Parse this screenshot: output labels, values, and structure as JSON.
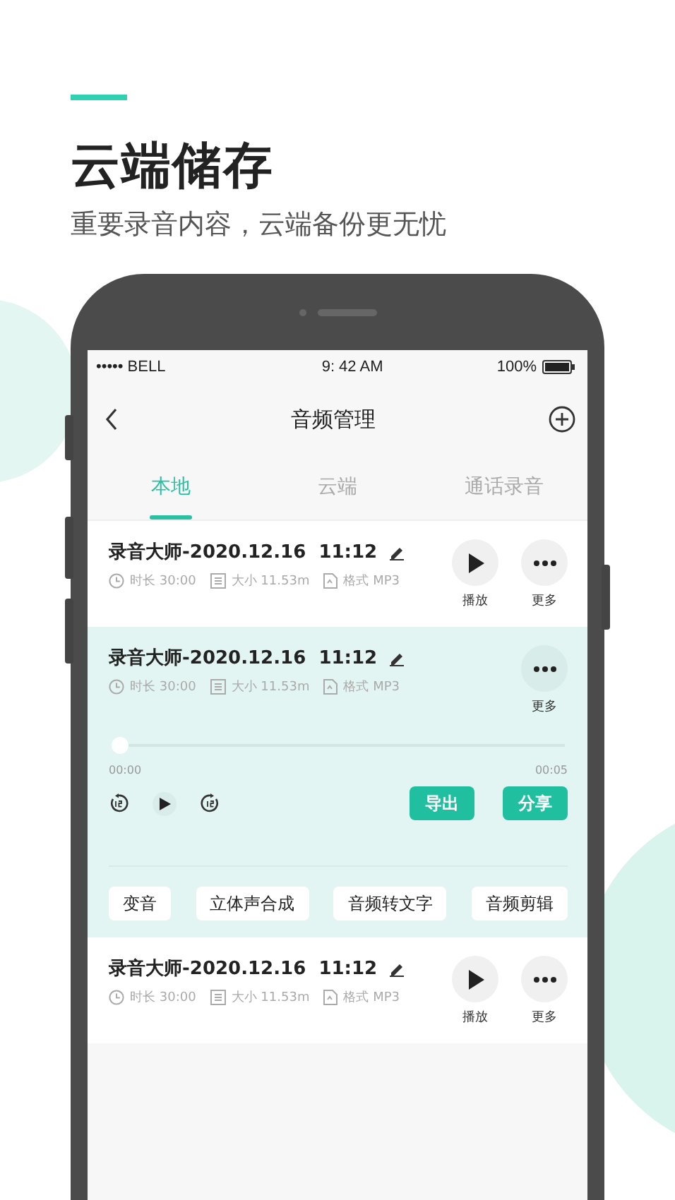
{
  "header": {
    "title": "云端储存",
    "subtitle": "重要录音内容，云端备份更无忧"
  },
  "status_bar": {
    "carrier": "••••• BELL",
    "time": "9: 42 AM",
    "battery": "100%"
  },
  "nav": {
    "title": "音频管理"
  },
  "tabs": [
    {
      "label": "本地",
      "selected": true
    },
    {
      "label": "云端",
      "selected": false
    },
    {
      "label": "通话录音",
      "selected": false
    }
  ],
  "recordings": [
    {
      "title": "录音大师-2020.12.16  11:12",
      "duration": "时长 30:00",
      "size": "大小 11.53m",
      "format": "格式 MP3",
      "expanded": false,
      "actions": [
        {
          "kind": "play",
          "label": "播放"
        },
        {
          "kind": "more",
          "label": "更多"
        }
      ]
    },
    {
      "title": "录音大师-2020.12.16  11:12",
      "duration": "时长 30:00",
      "size": "大小 11.53m",
      "format": "格式 MP3",
      "expanded": true,
      "actions": [
        {
          "kind": "more",
          "label": "更多"
        }
      ],
      "player": {
        "level": 0,
        "start": "00:00",
        "end": "00:05",
        "buttons": [
          "导出",
          "分享"
        ],
        "tools": [
          "变音",
          "立体声合成",
          "音频转文字",
          "音频剪辑"
        ]
      }
    },
    {
      "title": "录音大师-2020.12.16  11:12",
      "duration": "时长 30:00",
      "size": "大小 11.53m",
      "format": "格式 MP3",
      "expanded": false,
      "actions": [
        {
          "kind": "play",
          "label": "播放"
        },
        {
          "kind": "more",
          "label": "更多"
        }
      ]
    }
  ]
}
